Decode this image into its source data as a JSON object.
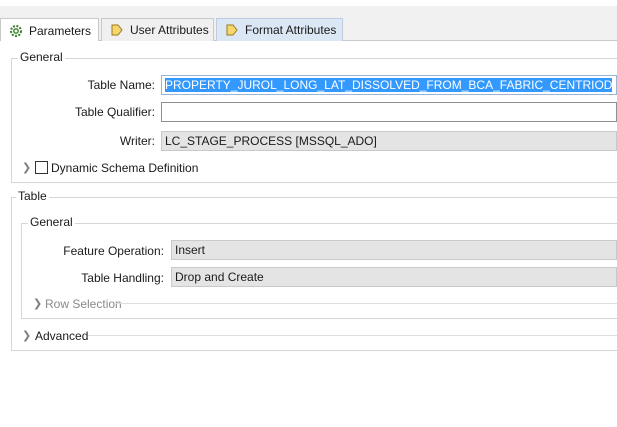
{
  "tabs": [
    {
      "label": "Parameters",
      "icon": "gear-icon"
    },
    {
      "label": "User Attributes",
      "icon": "arrow-tag-icon"
    },
    {
      "label": "Format Attributes",
      "icon": "arrow-tag-icon"
    }
  ],
  "general": {
    "title": "General",
    "table_name_label": "Table Name:",
    "table_name_value": "PROPERTY_JUROL_LONG_LAT_DISSOLVED_FROM_BCA_FABRIC_CENTRIOD",
    "table_qualifier_label": "Table Qualifier:",
    "table_qualifier_value": "",
    "writer_label": "Writer:",
    "writer_value": "LC_STAGE_PROCESS [MSSQL_ADO]",
    "dynamic_schema_label": "Dynamic Schema Definition",
    "dynamic_schema_checked": false
  },
  "table": {
    "title": "Table",
    "general_title": "General",
    "feature_operation_label": "Feature Operation:",
    "feature_operation_value": "Insert",
    "table_handling_label": "Table Handling:",
    "table_handling_value": "Drop and Create",
    "row_selection_label": "Row Selection",
    "advanced_label": "Advanced"
  },
  "colors": {
    "accent": "#3399ff",
    "tab_highlight": "#dbe7f5",
    "readonly": "#e4e4e4"
  }
}
